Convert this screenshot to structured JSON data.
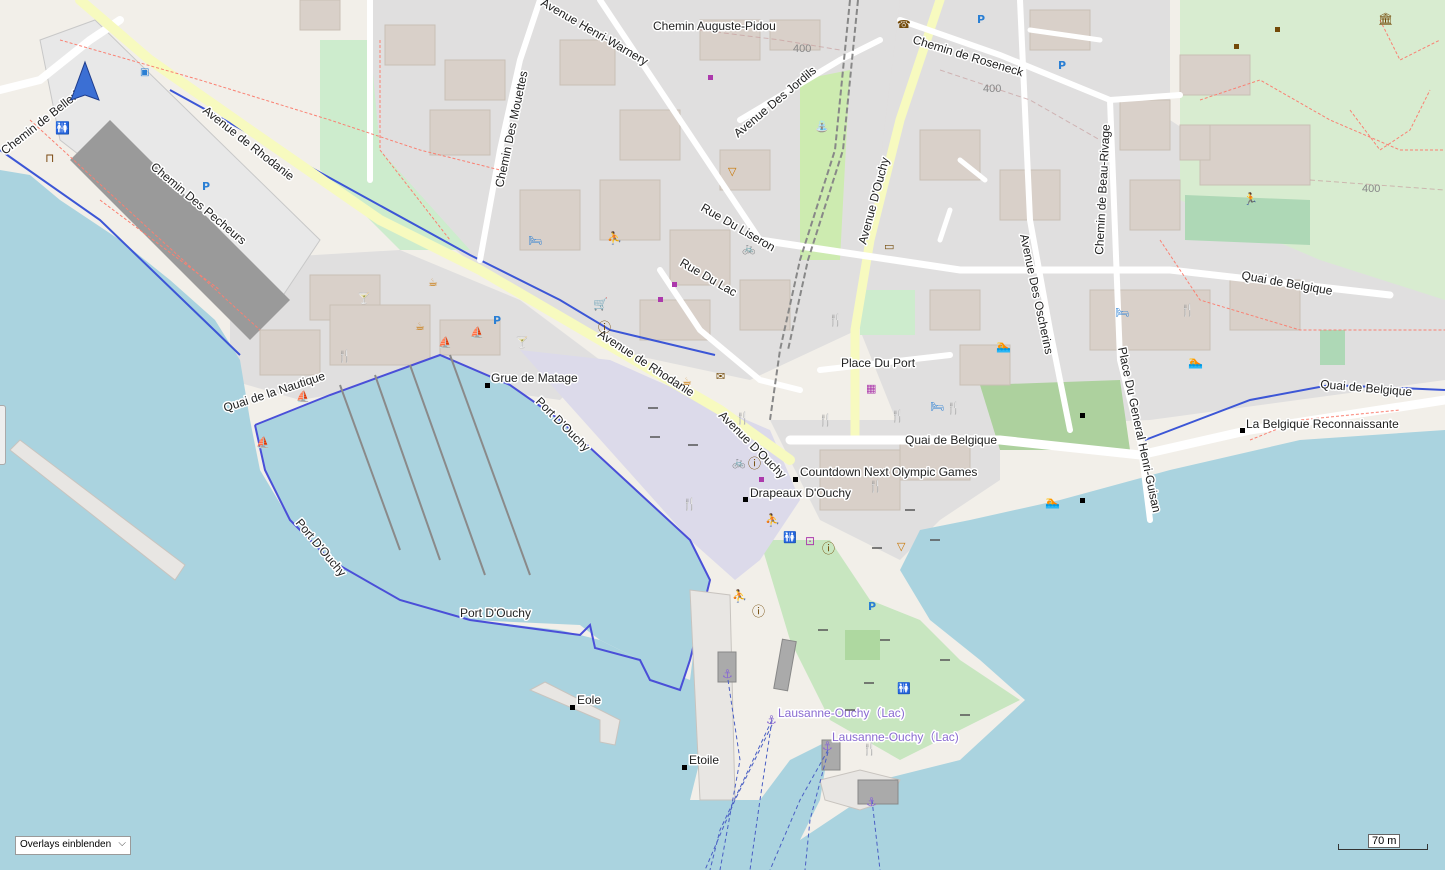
{
  "map": {
    "colors": {
      "water": "#aad3df",
      "land": "#f2efe9",
      "residential": "#e0dfdf",
      "building": "#d9d0c9",
      "park": "#c8facc",
      "grass": "#cdebb0",
      "pedestrian": "#dddde8",
      "road": "#ffffff",
      "primary": "#fcd6a4",
      "boundary": "#4a4fd8",
      "path": "#fa8072",
      "railway": "#999999",
      "ferry": "#4a5fc4"
    },
    "street_labels": [
      "Avenue Henri-Warnery",
      "Chemin Auguste-Pidou",
      "Chemin de Roseneck",
      "Chemin de Bellerive",
      "Avenue de Rhodanie",
      "Chemin Des Pecheurs",
      "Chemin Des Mouettes",
      "Avenue Des Jordils",
      "Rue Du Liseron",
      "Avenue D'Ouchy",
      "Avenue Des Oscherins",
      "Chemin de Beau-Rivage",
      "Rue Du Lac",
      "Place Du Port",
      "Quai de Belgique",
      "Place Du General Henri-Guisan",
      "Quai de la Nautique",
      "Port D'Ouchy",
      "Avenue de Rhodanie",
      "Avenue D'Ouchy",
      "Quai de Belgique",
      "Port D'Ouchy"
    ],
    "poi_labels": [
      "Grue de Matage",
      "Countdown Next Olympic Games",
      "Drapeaux D'Ouchy",
      "La Belgique Reconnaissante",
      "Port D'Ouchy",
      "Eole",
      "Etoile"
    ],
    "ferry_labels": [
      "Lausanne-Ouchy（Lac)",
      "Lausanne-Ouchy（Lac)"
    ],
    "contour_labels": [
      "400",
      "400",
      "400"
    ],
    "icons": [
      "position-arrow-icon",
      "toilets-icon",
      "picnic-table-icon",
      "parking-icon",
      "bus-stop-icon",
      "hotel-icon",
      "playground-icon",
      "restaurant-icon",
      "cafe-icon",
      "ice-cream-icon",
      "information-icon",
      "museum-icon",
      "sports-icon",
      "swimming-icon",
      "bicycle-icon",
      "post-office-icon",
      "bank-icon",
      "marina-icon",
      "ferry-terminal-icon",
      "bench-icon",
      "bar-icon",
      "shop-icon",
      "fountain-icon",
      "viewpoint-icon"
    ]
  },
  "controls": {
    "overlay_select": {
      "label": "Overlays einblenden",
      "chevron": "chevron-down-icon"
    },
    "scale": {
      "label": "70 m"
    }
  }
}
